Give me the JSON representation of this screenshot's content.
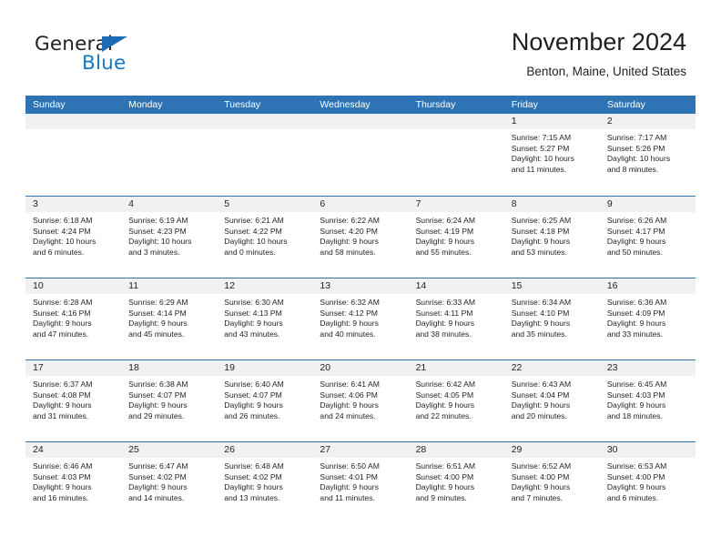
{
  "brand": {
    "name_part1": "General",
    "name_part2": "Blue",
    "accent_color": "#1679c4",
    "triangle_color": "#1f6cb4"
  },
  "header": {
    "title": "November 2024",
    "location": "Benton, Maine, United States"
  },
  "calendar": {
    "header_bg": "#2e74b5",
    "weekdays": [
      "Sunday",
      "Monday",
      "Tuesday",
      "Wednesday",
      "Thursday",
      "Friday",
      "Saturday"
    ],
    "weeks": [
      [
        {
          "day": "",
          "sunrise": "",
          "sunset": "",
          "daylight_line1": "",
          "daylight_line2": ""
        },
        {
          "day": "",
          "sunrise": "",
          "sunset": "",
          "daylight_line1": "",
          "daylight_line2": ""
        },
        {
          "day": "",
          "sunrise": "",
          "sunset": "",
          "daylight_line1": "",
          "daylight_line2": ""
        },
        {
          "day": "",
          "sunrise": "",
          "sunset": "",
          "daylight_line1": "",
          "daylight_line2": ""
        },
        {
          "day": "",
          "sunrise": "",
          "sunset": "",
          "daylight_line1": "",
          "daylight_line2": ""
        },
        {
          "day": "1",
          "sunrise": "Sunrise: 7:15 AM",
          "sunset": "Sunset: 5:27 PM",
          "daylight_line1": "Daylight: 10 hours",
          "daylight_line2": "and 11 minutes."
        },
        {
          "day": "2",
          "sunrise": "Sunrise: 7:17 AM",
          "sunset": "Sunset: 5:26 PM",
          "daylight_line1": "Daylight: 10 hours",
          "daylight_line2": "and 8 minutes."
        }
      ],
      [
        {
          "day": "3",
          "sunrise": "Sunrise: 6:18 AM",
          "sunset": "Sunset: 4:24 PM",
          "daylight_line1": "Daylight: 10 hours",
          "daylight_line2": "and 6 minutes."
        },
        {
          "day": "4",
          "sunrise": "Sunrise: 6:19 AM",
          "sunset": "Sunset: 4:23 PM",
          "daylight_line1": "Daylight: 10 hours",
          "daylight_line2": "and 3 minutes."
        },
        {
          "day": "5",
          "sunrise": "Sunrise: 6:21 AM",
          "sunset": "Sunset: 4:22 PM",
          "daylight_line1": "Daylight: 10 hours",
          "daylight_line2": "and 0 minutes."
        },
        {
          "day": "6",
          "sunrise": "Sunrise: 6:22 AM",
          "sunset": "Sunset: 4:20 PM",
          "daylight_line1": "Daylight: 9 hours",
          "daylight_line2": "and 58 minutes."
        },
        {
          "day": "7",
          "sunrise": "Sunrise: 6:24 AM",
          "sunset": "Sunset: 4:19 PM",
          "daylight_line1": "Daylight: 9 hours",
          "daylight_line2": "and 55 minutes."
        },
        {
          "day": "8",
          "sunrise": "Sunrise: 6:25 AM",
          "sunset": "Sunset: 4:18 PM",
          "daylight_line1": "Daylight: 9 hours",
          "daylight_line2": "and 53 minutes."
        },
        {
          "day": "9",
          "sunrise": "Sunrise: 6:26 AM",
          "sunset": "Sunset: 4:17 PM",
          "daylight_line1": "Daylight: 9 hours",
          "daylight_line2": "and 50 minutes."
        }
      ],
      [
        {
          "day": "10",
          "sunrise": "Sunrise: 6:28 AM",
          "sunset": "Sunset: 4:16 PM",
          "daylight_line1": "Daylight: 9 hours",
          "daylight_line2": "and 47 minutes."
        },
        {
          "day": "11",
          "sunrise": "Sunrise: 6:29 AM",
          "sunset": "Sunset: 4:14 PM",
          "daylight_line1": "Daylight: 9 hours",
          "daylight_line2": "and 45 minutes."
        },
        {
          "day": "12",
          "sunrise": "Sunrise: 6:30 AM",
          "sunset": "Sunset: 4:13 PM",
          "daylight_line1": "Daylight: 9 hours",
          "daylight_line2": "and 43 minutes."
        },
        {
          "day": "13",
          "sunrise": "Sunrise: 6:32 AM",
          "sunset": "Sunset: 4:12 PM",
          "daylight_line1": "Daylight: 9 hours",
          "daylight_line2": "and 40 minutes."
        },
        {
          "day": "14",
          "sunrise": "Sunrise: 6:33 AM",
          "sunset": "Sunset: 4:11 PM",
          "daylight_line1": "Daylight: 9 hours",
          "daylight_line2": "and 38 minutes."
        },
        {
          "day": "15",
          "sunrise": "Sunrise: 6:34 AM",
          "sunset": "Sunset: 4:10 PM",
          "daylight_line1": "Daylight: 9 hours",
          "daylight_line2": "and 35 minutes."
        },
        {
          "day": "16",
          "sunrise": "Sunrise: 6:36 AM",
          "sunset": "Sunset: 4:09 PM",
          "daylight_line1": "Daylight: 9 hours",
          "daylight_line2": "and 33 minutes."
        }
      ],
      [
        {
          "day": "17",
          "sunrise": "Sunrise: 6:37 AM",
          "sunset": "Sunset: 4:08 PM",
          "daylight_line1": "Daylight: 9 hours",
          "daylight_line2": "and 31 minutes."
        },
        {
          "day": "18",
          "sunrise": "Sunrise: 6:38 AM",
          "sunset": "Sunset: 4:07 PM",
          "daylight_line1": "Daylight: 9 hours",
          "daylight_line2": "and 29 minutes."
        },
        {
          "day": "19",
          "sunrise": "Sunrise: 6:40 AM",
          "sunset": "Sunset: 4:07 PM",
          "daylight_line1": "Daylight: 9 hours",
          "daylight_line2": "and 26 minutes."
        },
        {
          "day": "20",
          "sunrise": "Sunrise: 6:41 AM",
          "sunset": "Sunset: 4:06 PM",
          "daylight_line1": "Daylight: 9 hours",
          "daylight_line2": "and 24 minutes."
        },
        {
          "day": "21",
          "sunrise": "Sunrise: 6:42 AM",
          "sunset": "Sunset: 4:05 PM",
          "daylight_line1": "Daylight: 9 hours",
          "daylight_line2": "and 22 minutes."
        },
        {
          "day": "22",
          "sunrise": "Sunrise: 6:43 AM",
          "sunset": "Sunset: 4:04 PM",
          "daylight_line1": "Daylight: 9 hours",
          "daylight_line2": "and 20 minutes."
        },
        {
          "day": "23",
          "sunrise": "Sunrise: 6:45 AM",
          "sunset": "Sunset: 4:03 PM",
          "daylight_line1": "Daylight: 9 hours",
          "daylight_line2": "and 18 minutes."
        }
      ],
      [
        {
          "day": "24",
          "sunrise": "Sunrise: 6:46 AM",
          "sunset": "Sunset: 4:03 PM",
          "daylight_line1": "Daylight: 9 hours",
          "daylight_line2": "and 16 minutes."
        },
        {
          "day": "25",
          "sunrise": "Sunrise: 6:47 AM",
          "sunset": "Sunset: 4:02 PM",
          "daylight_line1": "Daylight: 9 hours",
          "daylight_line2": "and 14 minutes."
        },
        {
          "day": "26",
          "sunrise": "Sunrise: 6:48 AM",
          "sunset": "Sunset: 4:02 PM",
          "daylight_line1": "Daylight: 9 hours",
          "daylight_line2": "and 13 minutes."
        },
        {
          "day": "27",
          "sunrise": "Sunrise: 6:50 AM",
          "sunset": "Sunset: 4:01 PM",
          "daylight_line1": "Daylight: 9 hours",
          "daylight_line2": "and 11 minutes."
        },
        {
          "day": "28",
          "sunrise": "Sunrise: 6:51 AM",
          "sunset": "Sunset: 4:00 PM",
          "daylight_line1": "Daylight: 9 hours",
          "daylight_line2": "and 9 minutes."
        },
        {
          "day": "29",
          "sunrise": "Sunrise: 6:52 AM",
          "sunset": "Sunset: 4:00 PM",
          "daylight_line1": "Daylight: 9 hours",
          "daylight_line2": "and 7 minutes."
        },
        {
          "day": "30",
          "sunrise": "Sunrise: 6:53 AM",
          "sunset": "Sunset: 4:00 PM",
          "daylight_line1": "Daylight: 9 hours",
          "daylight_line2": "and 6 minutes."
        }
      ]
    ]
  }
}
